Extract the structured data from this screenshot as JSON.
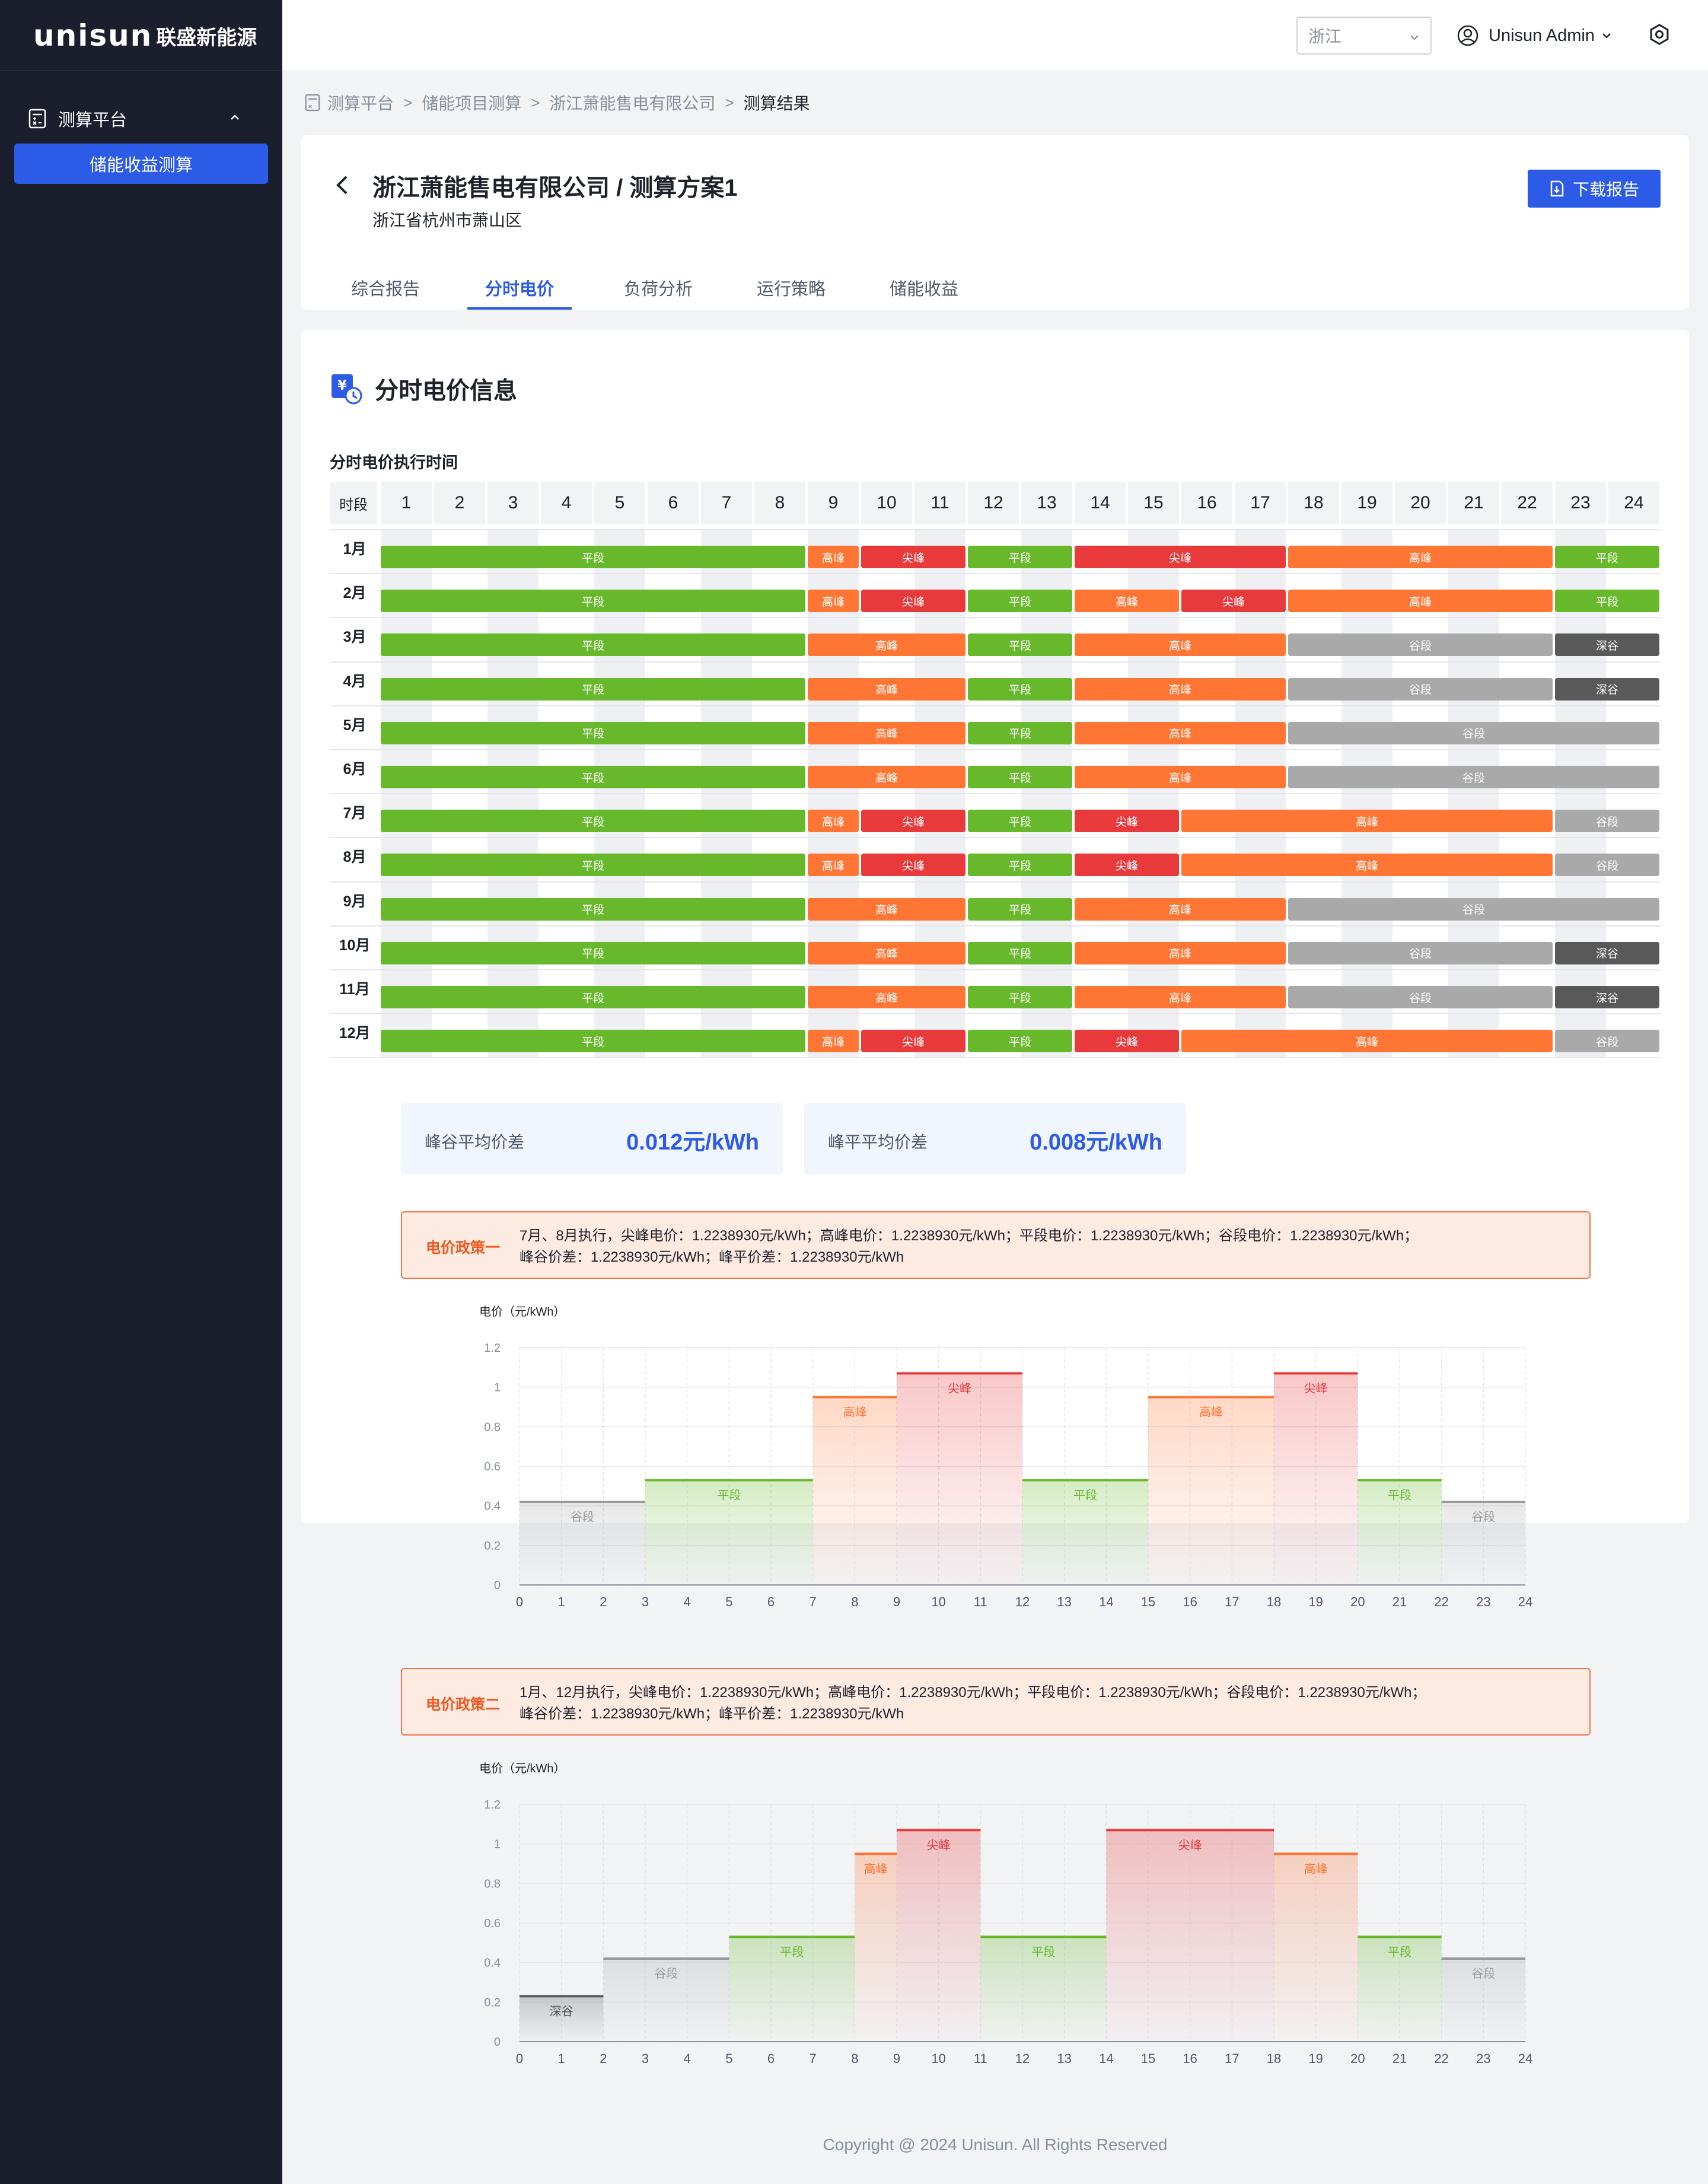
{
  "app": {
    "logo_word": "unisun",
    "logo_cn": "联盛新能源"
  },
  "sidebar": {
    "group_label": "测算平台",
    "items": [
      {
        "label": "储能收益测算",
        "active": true
      }
    ]
  },
  "topbar": {
    "region": "浙江",
    "user": "Unisun Admin"
  },
  "breadcrumb": [
    "测算平台",
    "储能项目测算",
    "浙江萧能售电有限公司",
    "测算结果"
  ],
  "header": {
    "title": "浙江萧能售电有限公司 / 测算方案1",
    "subtitle": "浙江省杭州市萧山区",
    "download_label": "下载报告",
    "tabs": [
      "综合报告",
      "分时电价",
      "负荷分析",
      "运行策略",
      "储能收益"
    ],
    "active_tab": "分时电价"
  },
  "section": {
    "title": "分时电价信息",
    "table_title": "分时电价执行时间",
    "time_header": "时段",
    "hours": [
      "1",
      "2",
      "3",
      "4",
      "5",
      "6",
      "7",
      "8",
      "9",
      "10",
      "11",
      "12",
      "13",
      "14",
      "15",
      "16",
      "17",
      "18",
      "19",
      "20",
      "21",
      "22",
      "23",
      "24"
    ]
  },
  "colors": {
    "平段": "#67b92b",
    "高峰": "#ff7533",
    "尖峰": "#e8393b",
    "谷段": "#a9a9a9",
    "深谷": "#595959",
    "primary": "#2c5be8"
  },
  "tou_schedule": [
    {
      "month": "1月",
      "segments": [
        [
          "平段",
          1,
          8
        ],
        [
          "高峰",
          9,
          9
        ],
        [
          "尖峰",
          10,
          11
        ],
        [
          "平段",
          12,
          13
        ],
        [
          "尖峰",
          14,
          17
        ],
        [
          "高峰",
          18,
          22
        ],
        [
          "平段",
          23,
          24
        ]
      ]
    },
    {
      "month": "2月",
      "segments": [
        [
          "平段",
          1,
          8
        ],
        [
          "高峰",
          9,
          9
        ],
        [
          "尖峰",
          10,
          11
        ],
        [
          "平段",
          12,
          13
        ],
        [
          "高峰",
          14,
          15
        ],
        [
          "尖峰",
          16,
          17
        ],
        [
          "高峰",
          18,
          22
        ],
        [
          "平段",
          23,
          24
        ]
      ]
    },
    {
      "month": "3月",
      "segments": [
        [
          "平段",
          1,
          8
        ],
        [
          "高峰",
          9,
          11
        ],
        [
          "平段",
          12,
          13
        ],
        [
          "高峰",
          14,
          17
        ],
        [
          "谷段",
          18,
          22
        ],
        [
          "深谷",
          23,
          24
        ]
      ]
    },
    {
      "month": "4月",
      "segments": [
        [
          "平段",
          1,
          8
        ],
        [
          "高峰",
          9,
          11
        ],
        [
          "平段",
          12,
          13
        ],
        [
          "高峰",
          14,
          17
        ],
        [
          "谷段",
          18,
          22
        ],
        [
          "深谷",
          23,
          24
        ]
      ]
    },
    {
      "month": "5月",
      "segments": [
        [
          "平段",
          1,
          8
        ],
        [
          "高峰",
          9,
          11
        ],
        [
          "平段",
          12,
          13
        ],
        [
          "高峰",
          14,
          17
        ],
        [
          "谷段",
          18,
          24
        ]
      ]
    },
    {
      "month": "6月",
      "segments": [
        [
          "平段",
          1,
          8
        ],
        [
          "高峰",
          9,
          11
        ],
        [
          "平段",
          12,
          13
        ],
        [
          "高峰",
          14,
          17
        ],
        [
          "谷段",
          18,
          24
        ]
      ]
    },
    {
      "month": "7月",
      "segments": [
        [
          "平段",
          1,
          8
        ],
        [
          "高峰",
          9,
          9
        ],
        [
          "尖峰",
          10,
          11
        ],
        [
          "平段",
          12,
          13
        ],
        [
          "尖峰",
          14,
          15
        ],
        [
          "高峰",
          16,
          22
        ],
        [
          "谷段",
          23,
          24
        ]
      ]
    },
    {
      "month": "8月",
      "segments": [
        [
          "平段",
          1,
          8
        ],
        [
          "高峰",
          9,
          9
        ],
        [
          "尖峰",
          10,
          11
        ],
        [
          "平段",
          12,
          13
        ],
        [
          "尖峰",
          14,
          15
        ],
        [
          "高峰",
          16,
          22
        ],
        [
          "谷段",
          23,
          24
        ]
      ]
    },
    {
      "month": "9月",
      "segments": [
        [
          "平段",
          1,
          8
        ],
        [
          "高峰",
          9,
          11
        ],
        [
          "平段",
          12,
          13
        ],
        [
          "高峰",
          14,
          17
        ],
        [
          "谷段",
          18,
          24
        ]
      ]
    },
    {
      "month": "10月",
      "segments": [
        [
          "平段",
          1,
          8
        ],
        [
          "高峰",
          9,
          11
        ],
        [
          "平段",
          12,
          13
        ],
        [
          "高峰",
          14,
          17
        ],
        [
          "谷段",
          18,
          22
        ],
        [
          "深谷",
          23,
          24
        ]
      ]
    },
    {
      "month": "11月",
      "segments": [
        [
          "平段",
          1,
          8
        ],
        [
          "高峰",
          9,
          11
        ],
        [
          "平段",
          12,
          13
        ],
        [
          "高峰",
          14,
          17
        ],
        [
          "谷段",
          18,
          22
        ],
        [
          "深谷",
          23,
          24
        ]
      ]
    },
    {
      "month": "12月",
      "segments": [
        [
          "平段",
          1,
          8
        ],
        [
          "高峰",
          9,
          9
        ],
        [
          "尖峰",
          10,
          11
        ],
        [
          "平段",
          12,
          13
        ],
        [
          "尖峰",
          14,
          15
        ],
        [
          "高峰",
          16,
          22
        ],
        [
          "谷段",
          23,
          24
        ]
      ]
    }
  ],
  "stats": [
    {
      "label": "峰谷平均价差",
      "value": "0.012元/kWh"
    },
    {
      "label": "峰平平均价差",
      "value": "0.008元/kWh"
    }
  ],
  "policies": [
    {
      "label": "电价政策一",
      "text_line1": "7月、8月执行，尖峰电价：1.2238930元/kWh；高峰电价：1.2238930元/kWh；平段电价：1.2238930元/kWh；谷段电价：1.2238930元/kWh；",
      "text_line2": "峰谷价差：1.2238930元/kWh；峰平价差：1.2238930元/kWh"
    },
    {
      "label": "电价政策二",
      "text_line1": "1月、12月执行，尖峰电价：1.2238930元/kWh；高峰电价：1.2238930元/kWh；平段电价：1.2238930元/kWh；谷段电价：1.2238930元/kWh；",
      "text_line2": "峰谷价差：1.2238930元/kWh；峰平价差：1.2238930元/kWh"
    }
  ],
  "chart_data": [
    {
      "type": "area",
      "title": "",
      "ylabel": "电价（元/kWh）",
      "xlabel": "",
      "xlim": [
        0,
        24
      ],
      "ylim": [
        0,
        1.2
      ],
      "xticks": [
        0,
        1,
        2,
        3,
        4,
        5,
        6,
        7,
        8,
        9,
        10,
        11,
        12,
        13,
        14,
        15,
        16,
        17,
        18,
        19,
        20,
        21,
        22,
        23,
        24
      ],
      "yticks": [
        0,
        0.2,
        0.4,
        0.6,
        0.8,
        1.0,
        1.2
      ],
      "grid": true,
      "segments": [
        {
          "name": "谷段",
          "x0": 0,
          "x1": 3,
          "y": 0.42
        },
        {
          "name": "平段",
          "x0": 3,
          "x1": 7,
          "y": 0.53
        },
        {
          "name": "高峰",
          "x0": 7,
          "x1": 9,
          "y": 0.95
        },
        {
          "name": "尖峰",
          "x0": 9,
          "x1": 12,
          "y": 1.07
        },
        {
          "name": "平段",
          "x0": 12,
          "x1": 15,
          "y": 0.53
        },
        {
          "name": "高峰",
          "x0": 15,
          "x1": 18,
          "y": 0.95
        },
        {
          "name": "尖峰",
          "x0": 18,
          "x1": 20,
          "y": 1.07
        },
        {
          "name": "平段",
          "x0": 20,
          "x1": 22,
          "y": 0.53
        },
        {
          "name": "谷段",
          "x0": 22,
          "x1": 24,
          "y": 0.42
        }
      ]
    },
    {
      "type": "area",
      "title": "",
      "ylabel": "电价（元/kWh）",
      "xlabel": "",
      "xlim": [
        0,
        24
      ],
      "ylim": [
        0,
        1.2
      ],
      "xticks": [
        0,
        1,
        2,
        3,
        4,
        5,
        6,
        7,
        8,
        9,
        10,
        11,
        12,
        13,
        14,
        15,
        16,
        17,
        18,
        19,
        20,
        21,
        22,
        23,
        24
      ],
      "yticks": [
        0,
        0.2,
        0.4,
        0.6,
        0.8,
        1.0,
        1.2
      ],
      "grid": true,
      "segments": [
        {
          "name": "深谷",
          "x0": 0,
          "x1": 2,
          "y": 0.23
        },
        {
          "name": "谷段",
          "x0": 2,
          "x1": 5,
          "y": 0.42
        },
        {
          "name": "平段",
          "x0": 5,
          "x1": 8,
          "y": 0.53
        },
        {
          "name": "高峰",
          "x0": 8,
          "x1": 9,
          "y": 0.95
        },
        {
          "name": "尖峰",
          "x0": 9,
          "x1": 11,
          "y": 1.07
        },
        {
          "name": "平段",
          "x0": 11,
          "x1": 14,
          "y": 0.53
        },
        {
          "name": "尖峰",
          "x0": 14,
          "x1": 18,
          "y": 1.07
        },
        {
          "name": "高峰",
          "x0": 18,
          "x1": 20,
          "y": 0.95
        },
        {
          "name": "平段",
          "x0": 20,
          "x1": 22,
          "y": 0.53
        },
        {
          "name": "谷段",
          "x0": 22,
          "x1": 24,
          "y": 0.42
        }
      ]
    }
  ],
  "footer": "Copyright @ 2024 Unisun. All Rights Reserved"
}
